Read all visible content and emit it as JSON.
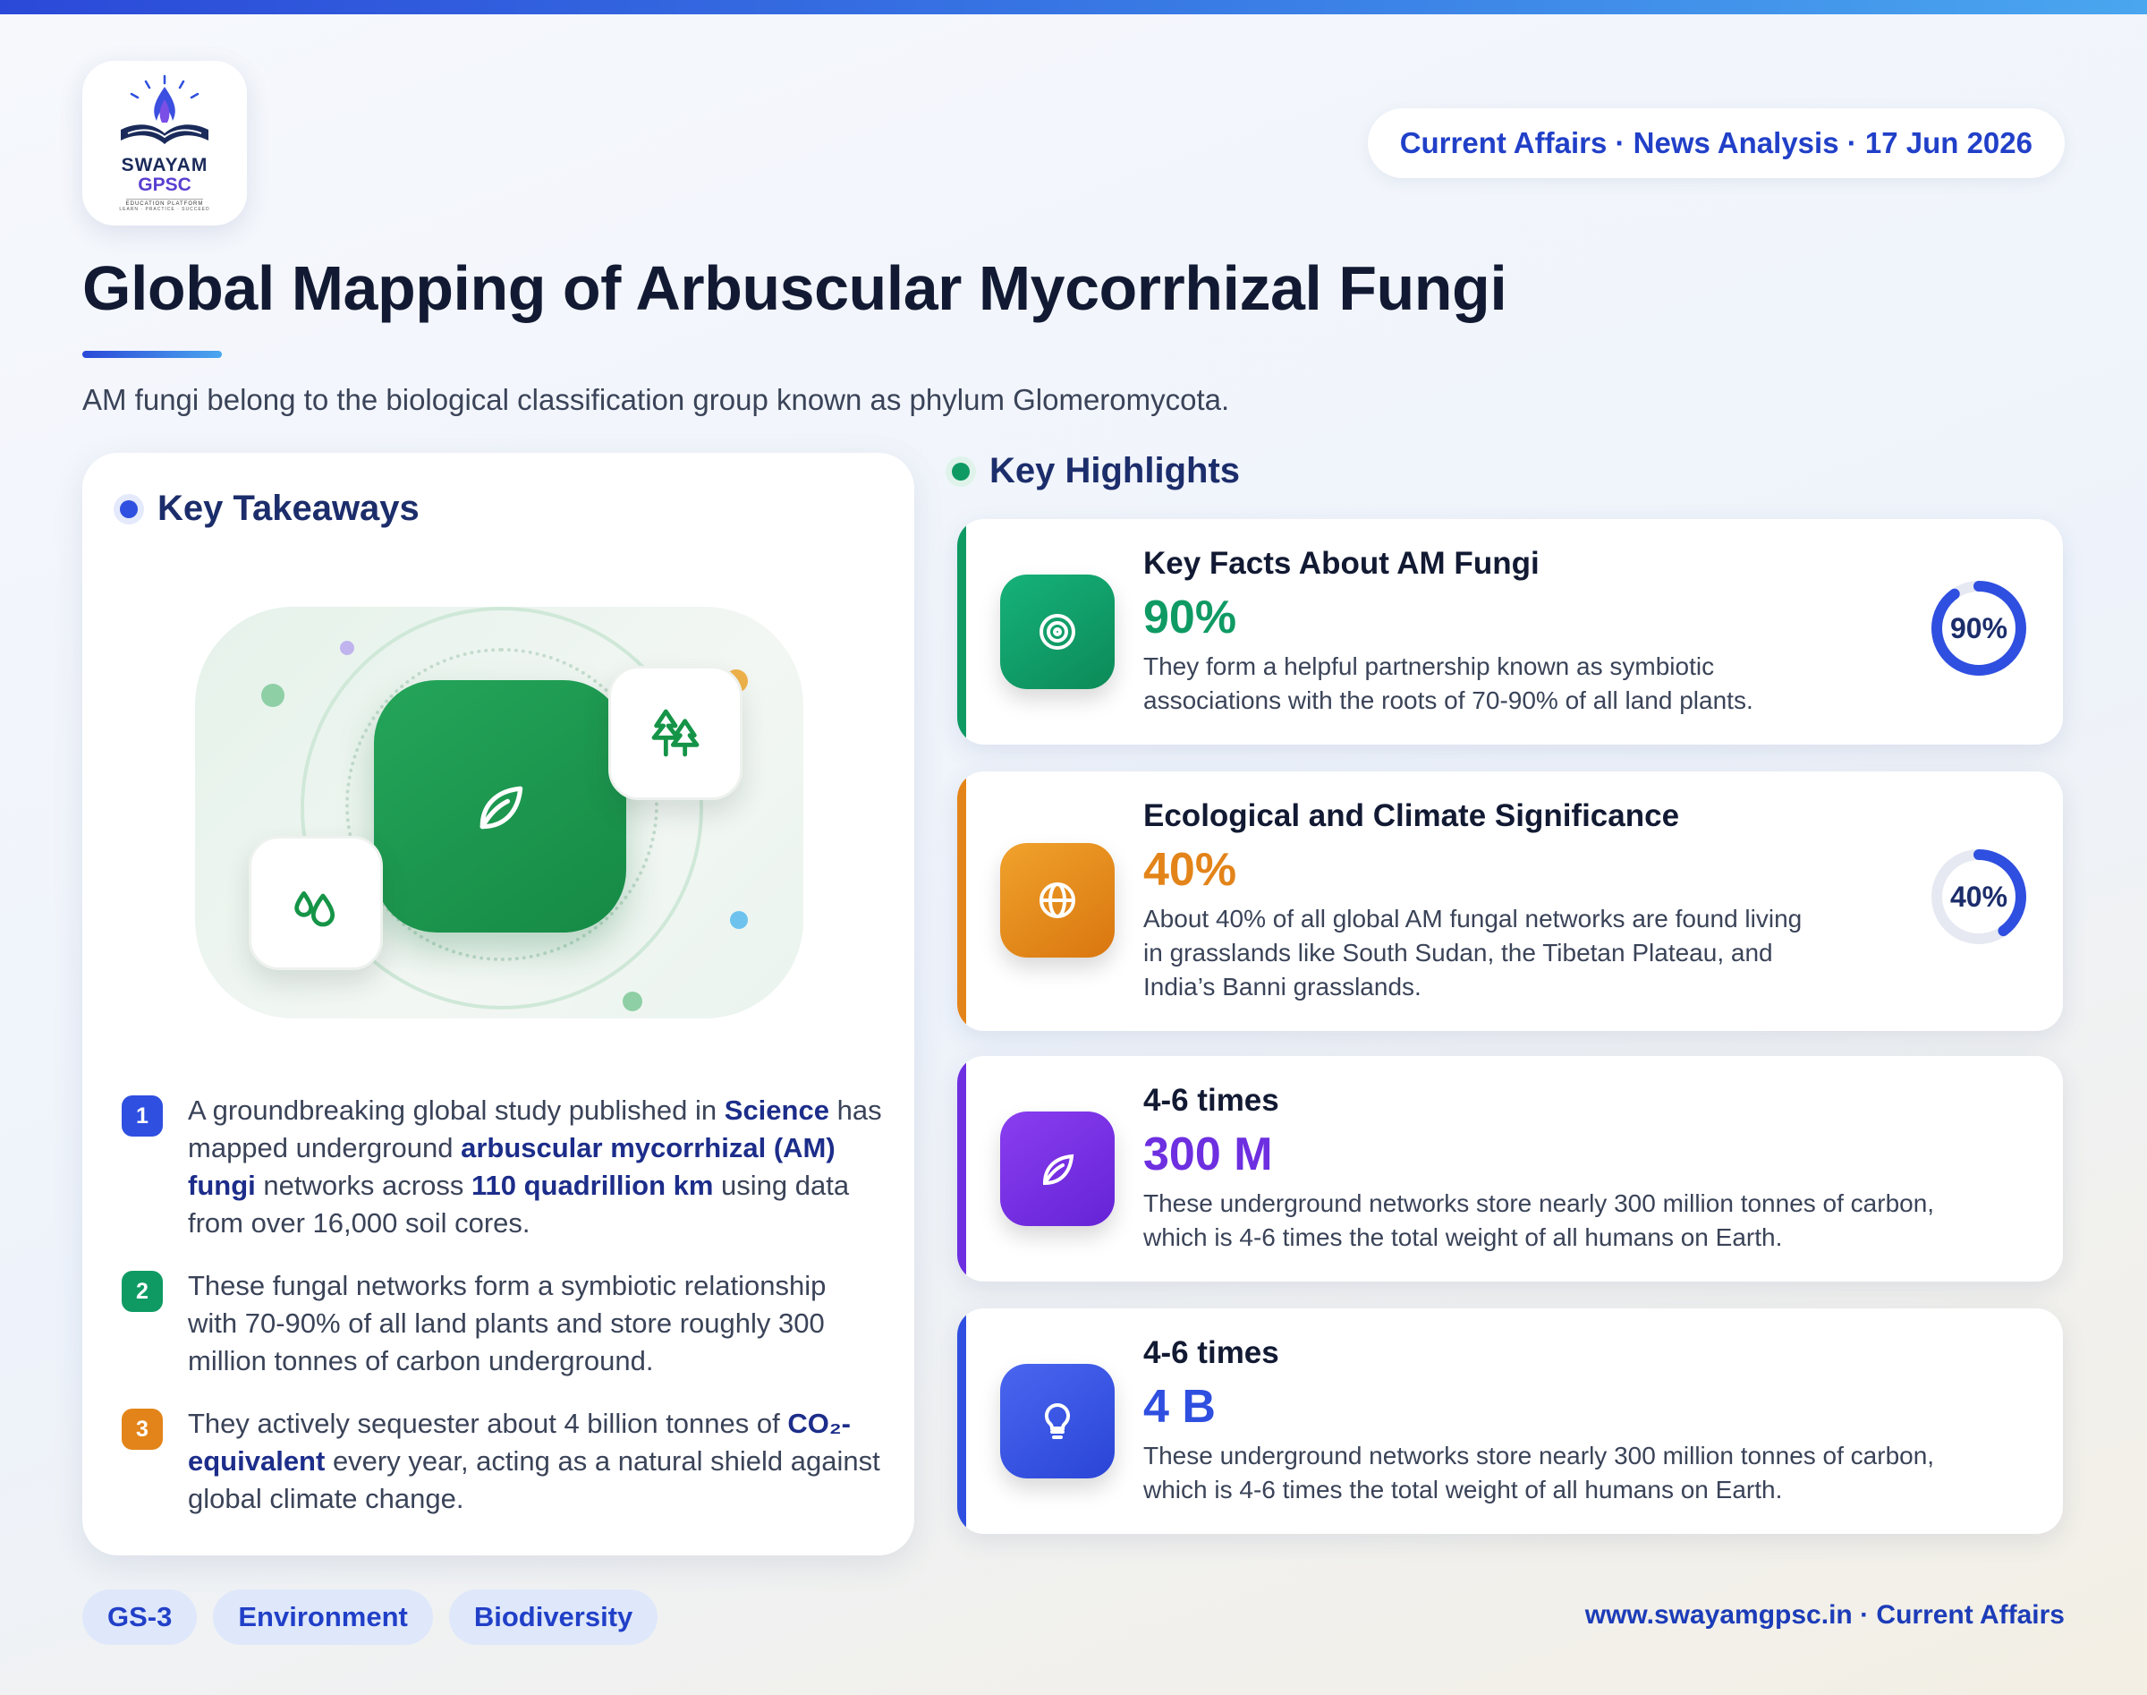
{
  "brand": {
    "logo_line1": "SWAYAM",
    "logo_line2": "GPSC",
    "logo_line3": "EDUCATION PLATFORM",
    "logo_line4": "LEARN · PRACTICE · SUCCEED"
  },
  "header": {
    "meta": "Current Affairs · News Analysis · 17 Jun 2026",
    "title": "Global Mapping of Arbuscular Mycorrhizal Fungi",
    "subtitle": "AM fungi belong to the biological classification group known as phylum Glomeromycota."
  },
  "takeaways": {
    "heading": "Key Takeaways",
    "items": [
      {
        "num": "1",
        "parts": [
          {
            "t": "A groundbreaking global study published in ",
            "b": false
          },
          {
            "t": "Science",
            "b": true
          },
          {
            "t": " has mapped underground ",
            "b": false
          },
          {
            "t": "arbuscular mycorrhizal (AM) fungi",
            "b": true
          },
          {
            "t": " networks across ",
            "b": false
          },
          {
            "t": "110 quadrillion km",
            "b": true
          },
          {
            "t": " using data from over 16,000 soil cores.",
            "b": false
          }
        ]
      },
      {
        "num": "2",
        "parts": [
          {
            "t": "These fungal networks form a symbiotic relationship with 70-90% of all land plants and store roughly 300 million tonnes of carbon underground.",
            "b": false
          }
        ]
      },
      {
        "num": "3",
        "parts": [
          {
            "t": "They actively sequester about 4 billion tonnes of ",
            "b": false
          },
          {
            "t": "CO₂-equivalent",
            "b": true
          },
          {
            "t": " every year, acting as a natural shield against global climate change.",
            "b": false
          }
        ]
      }
    ]
  },
  "highlights": {
    "heading": "Key Highlights",
    "cards": [
      {
        "heading": "Key Facts About AM Fungi",
        "value": "90%",
        "desc_line1": "They form a helpful partnership known as symbiotic",
        "desc_line2": "associations with the roots of 70-90% of all land plants.",
        "desc_line3": "",
        "ring_label": "90%",
        "ring_fraction": 0.9,
        "icon": "target-icon",
        "accent": "#0f9a64"
      },
      {
        "heading": "Ecological and Climate Significance",
        "value": "40%",
        "desc_line1": "About 40% of all global AM fungal networks are found living",
        "desc_line2": "in grasslands like South Sudan, the Tibetan Plateau, and",
        "desc_line3": "India’s Banni grasslands.",
        "ring_label": "40%",
        "ring_fraction": 0.4,
        "icon": "globe-icon",
        "accent": "#e3841a"
      },
      {
        "heading": "4-6 times",
        "value": "300 M",
        "desc_line1": "These underground networks store nearly 300 million tonnes of carbon,",
        "desc_line2": "which is 4-6 times the total weight of all humans on Earth.",
        "desc_line3": "",
        "icon": "leaf-icon",
        "accent": "#6d2fe0"
      },
      {
        "heading": "4-6 times",
        "value": "4 B",
        "desc_line1": "These underground networks store nearly 300 million tonnes of carbon,",
        "desc_line2": "which is 4-6 times the total weight of all humans on Earth.",
        "desc_line3": "",
        "icon": "lightbulb-icon",
        "accent": "#2f4fe0"
      }
    ]
  },
  "tags": [
    "GS-3",
    "Environment",
    "Biodiversity"
  ],
  "footer": "www.swayamgpsc.in · Current Affairs",
  "colors": {
    "primary_blue": "#2f4fe0",
    "green": "#0f9a64",
    "orange": "#e3841a",
    "purple": "#6d2fe0",
    "title_dark": "#121a33"
  }
}
